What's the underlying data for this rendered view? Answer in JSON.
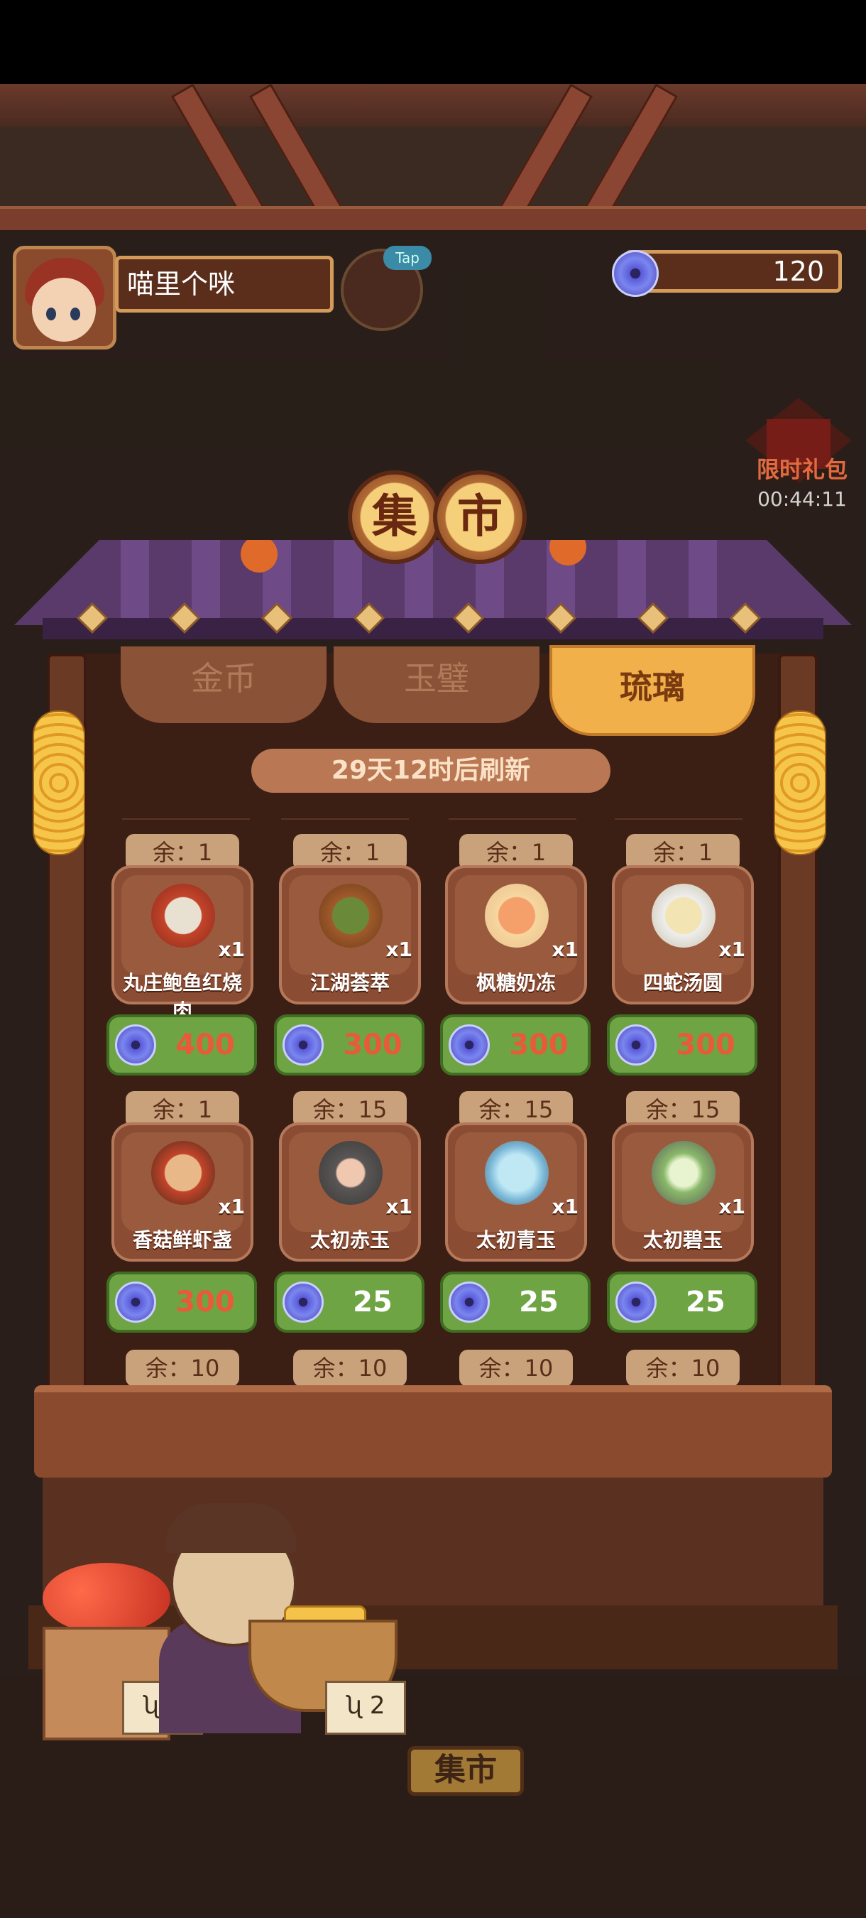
{
  "header": {
    "player_name": "喵里个咪",
    "tap_label": "Tap",
    "jade_balance": "120"
  },
  "promo": {
    "label": "限时礼包",
    "countdown": "00:44:11"
  },
  "shop": {
    "title_chars": [
      "集",
      "市"
    ],
    "tabs": [
      {
        "label": "金币",
        "active": false
      },
      {
        "label": "玉璧",
        "active": false
      },
      {
        "label": "琉璃",
        "active": true
      }
    ],
    "refresh_text": "29天12时后刷新",
    "items": [
      {
        "remain": "余：1",
        "name": "丸庄鲍鱼红烧肉",
        "qty": "x1",
        "price": "400",
        "price_color": "#e85a3a",
        "icon": "braised-pork-abalone-icon"
      },
      {
        "remain": "余：1",
        "name": "江湖荟萃",
        "qty": "x1",
        "price": "300",
        "price_color": "#e85a3a",
        "icon": "jianghu-dish-icon"
      },
      {
        "remain": "余：1",
        "name": "枫糖奶冻",
        "qty": "x1",
        "price": "300",
        "price_color": "#e85a3a",
        "icon": "maple-pudding-icon"
      },
      {
        "remain": "余：1",
        "name": "四蛇汤圆",
        "qty": "x1",
        "price": "300",
        "price_color": "#e85a3a",
        "icon": "dumpling-soup-icon"
      },
      {
        "remain": "余：1",
        "name": "香菇鲜虾盏",
        "qty": "x1",
        "price": "300",
        "price_color": "#e85a3a",
        "icon": "shrimp-cup-icon"
      },
      {
        "remain": "余：15",
        "name": "太初赤玉",
        "qty": "x1",
        "price": "25",
        "price_color": "#ffffff",
        "icon": "red-jade-ore-icon"
      },
      {
        "remain": "余：15",
        "name": "太初青玉",
        "qty": "x1",
        "price": "25",
        "price_color": "#ffffff",
        "icon": "blue-jade-ore-icon"
      },
      {
        "remain": "余：15",
        "name": "太初碧玉",
        "qty": "x1",
        "price": "25",
        "price_color": "#ffffff",
        "icon": "green-jade-ore-icon"
      }
    ],
    "partial_row_remain": [
      "余：10",
      "余：10",
      "余：10",
      "余：10"
    ]
  },
  "stall": {
    "left_tag": "ʯ 2",
    "right_tag": "ʯ 2",
    "market_sign": "集市"
  },
  "colors": {
    "accent": "#f2b04a",
    "price_bg": "#6fa444",
    "sold_out_price": "#e85a3a"
  }
}
